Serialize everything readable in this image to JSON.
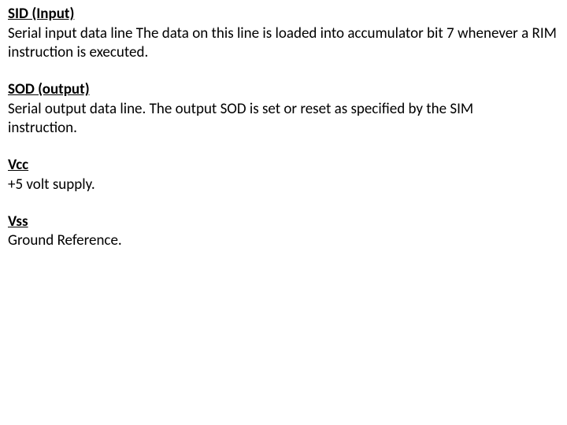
{
  "sections": [
    {
      "heading": "SID (Input)",
      "body": "Serial input data line The data on this line is loaded into accumulator bit 7 whenever a RIM instruction is executed."
    },
    {
      "heading": "SOD (output)",
      "body": "Serial output data line. The output SOD is set or reset as specified by the SIM\ninstruction."
    },
    {
      "heading": "Vcc",
      "body": "+5 volt supply."
    },
    {
      "heading": "Vss",
      "body": "Ground Reference."
    }
  ]
}
